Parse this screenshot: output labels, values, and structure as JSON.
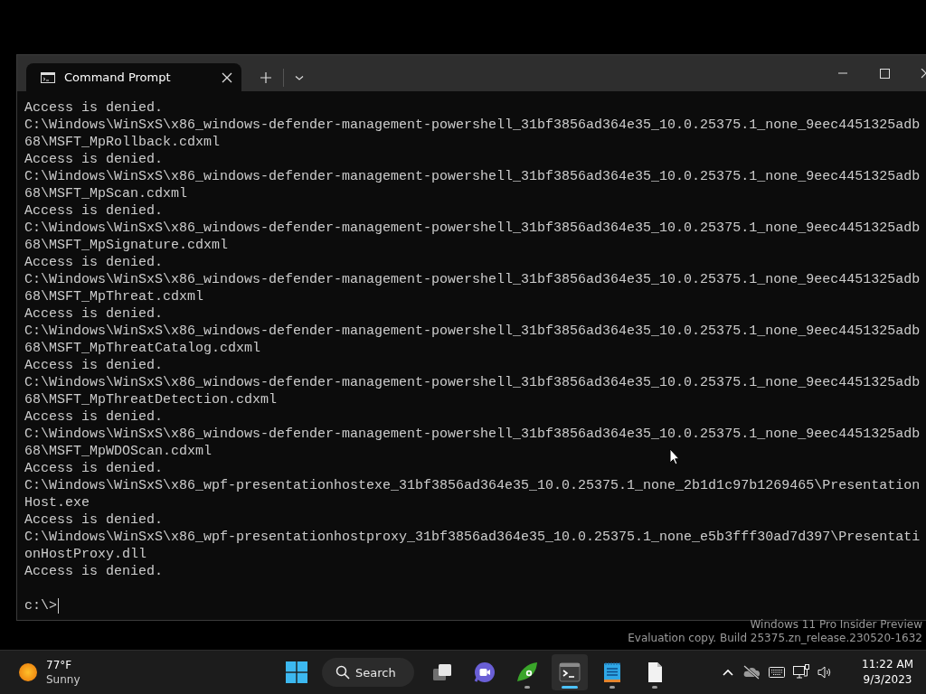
{
  "window": {
    "tabs": [
      {
        "title": "Command Prompt",
        "selected": true
      }
    ],
    "lines": [
      "Access is denied.",
      "C:\\Windows\\WinSxS\\x86_windows-defender-management-powershell_31bf3856ad364e35_10.0.25375.1_none_9eec4451325adb",
      "68\\MSFT_MpRollback.cdxml",
      "Access is denied.",
      "C:\\Windows\\WinSxS\\x86_windows-defender-management-powershell_31bf3856ad364e35_10.0.25375.1_none_9eec4451325adb",
      "68\\MSFT_MpScan.cdxml",
      "Access is denied.",
      "C:\\Windows\\WinSxS\\x86_windows-defender-management-powershell_31bf3856ad364e35_10.0.25375.1_none_9eec4451325adb",
      "68\\MSFT_MpSignature.cdxml",
      "Access is denied.",
      "C:\\Windows\\WinSxS\\x86_windows-defender-management-powershell_31bf3856ad364e35_10.0.25375.1_none_9eec4451325adb",
      "68\\MSFT_MpThreat.cdxml",
      "Access is denied.",
      "C:\\Windows\\WinSxS\\x86_windows-defender-management-powershell_31bf3856ad364e35_10.0.25375.1_none_9eec4451325adb",
      "68\\MSFT_MpThreatCatalog.cdxml",
      "Access is denied.",
      "C:\\Windows\\WinSxS\\x86_windows-defender-management-powershell_31bf3856ad364e35_10.0.25375.1_none_9eec4451325adb",
      "68\\MSFT_MpThreatDetection.cdxml",
      "Access is denied.",
      "C:\\Windows\\WinSxS\\x86_windows-defender-management-powershell_31bf3856ad364e35_10.0.25375.1_none_9eec4451325adb",
      "68\\MSFT_MpWDOScan.cdxml",
      "Access is denied.",
      "C:\\Windows\\WinSxS\\x86_wpf-presentationhostexe_31bf3856ad364e35_10.0.25375.1_none_2b1d1c97b1269465\\Presentation",
      "Host.exe",
      "Access is denied.",
      "C:\\Windows\\WinSxS\\x86_wpf-presentationhostproxy_31bf3856ad364e35_10.0.25375.1_none_e5b3fff30ad7d397\\Presentati",
      "onHostProxy.dll",
      "Access is denied."
    ],
    "prompt": "c:\\>"
  },
  "watermark": [
    "Windows 11 Pro Insider Preview",
    "Evaluation copy. Build 25375.zn_release.230520-1632"
  ],
  "taskbar": {
    "weather": {
      "temperature": "77°F",
      "condition": "Sunny"
    },
    "search": {
      "label": "Search"
    },
    "apps": [
      {
        "kind": "task-view",
        "running": false,
        "active": false
      },
      {
        "kind": "video-chat",
        "running": false,
        "active": false
      },
      {
        "kind": "leaf",
        "running": true,
        "active": false
      },
      {
        "kind": "terminal",
        "running": true,
        "active": true
      },
      {
        "kind": "notepad",
        "running": true,
        "active": false
      },
      {
        "kind": "file",
        "running": true,
        "active": false
      }
    ],
    "clock": {
      "time": "11:22 AM",
      "date": "9/3/2023"
    }
  }
}
